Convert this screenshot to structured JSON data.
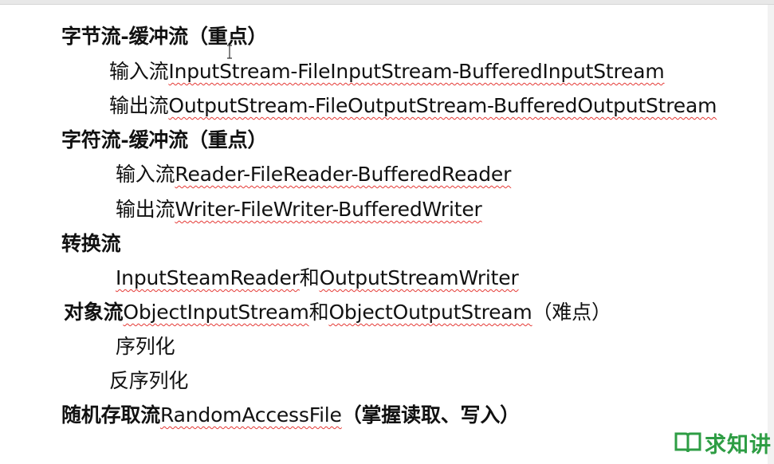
{
  "lines": [
    {
      "heading": "字节流-缓冲流",
      "paren": "（重点）"
    },
    {
      "cn": "输入流",
      "en": "InputStream-FileInputStream-BufferedInputStream"
    },
    {
      "cn": "输出流",
      "en": "OutputStream-FileOutputStream-BufferedOutputStream"
    },
    {
      "heading": "字符流-缓冲流",
      "paren": "（重点）"
    },
    {
      "cn": "输入流",
      "en": "Reader-FileReader-BufferedReader"
    },
    {
      "cn": "输出流",
      "en": "Writer-FileWriter-BufferedWriter"
    },
    {
      "heading": "转换流"
    },
    {
      "en_a": "InputSteamReader",
      "cn": "和",
      "en_b": "OutputStreamWriter"
    },
    {
      "heading": "对象流",
      "en_a": "ObjectInputStream",
      "cn": "和",
      "en_b": "ObjectOutputStream",
      "paren": "（难点）"
    },
    {
      "cn": "序列化"
    },
    {
      "cn": "反序列化"
    },
    {
      "heading": "随机存取流",
      "en": "RandomAccessFile",
      "paren_bold": "（掌握读取、写入）"
    }
  ],
  "logo": {
    "text": "求知讲",
    "icon": "open-book-icon",
    "color": "#2e9d44"
  },
  "wavy_underline_color": "#e53935"
}
